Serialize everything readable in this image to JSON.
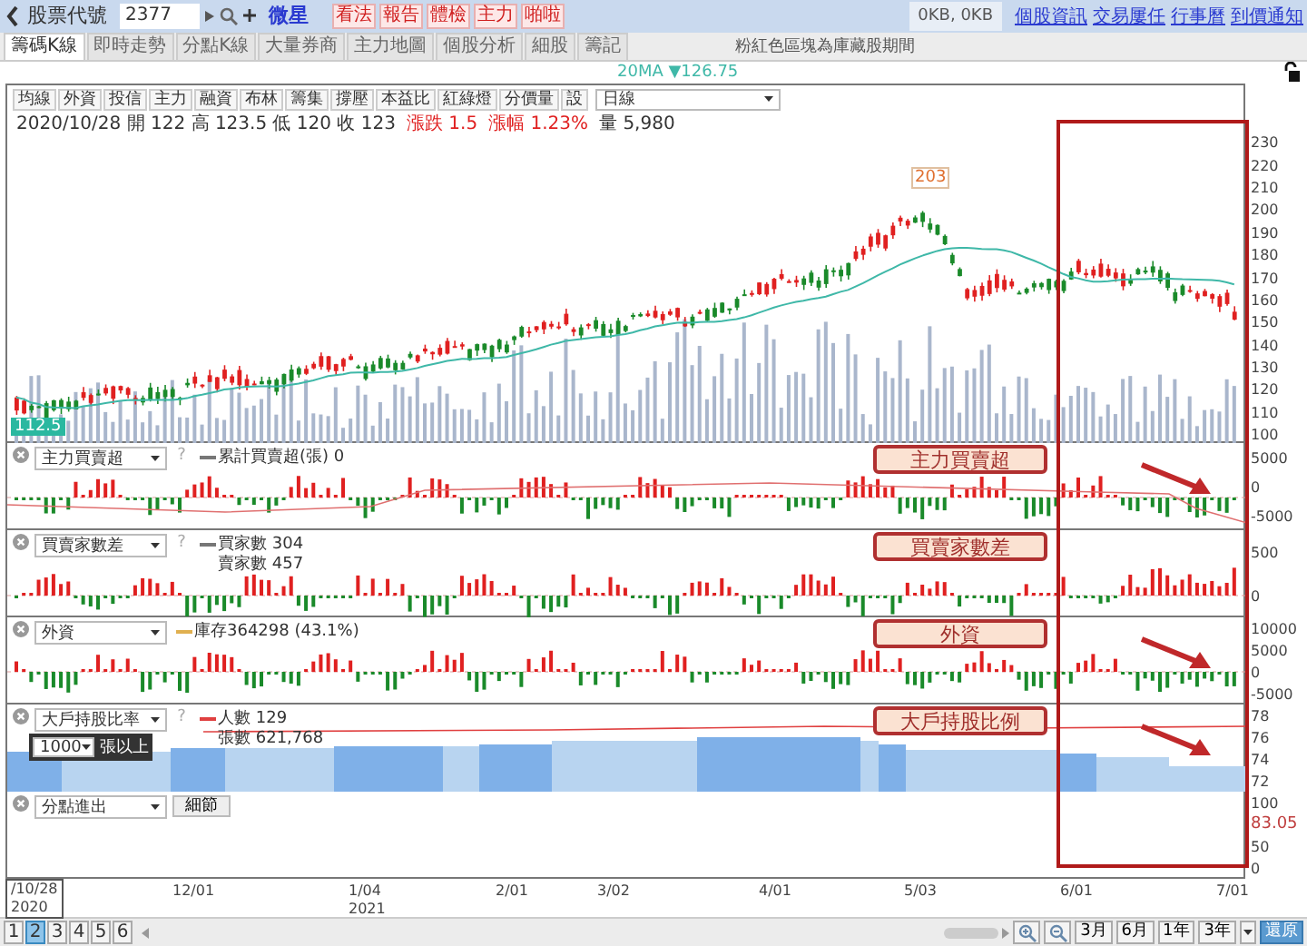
{
  "header": {
    "code_label": "股票代號",
    "code_value": "2377",
    "stock_name": "微星",
    "action_buttons": [
      "看法",
      "報告",
      "體檢",
      "主力",
      "啪啦"
    ],
    "traffic": "0KB, 0KB",
    "links": [
      "個股資訊",
      "交易屢任",
      "行事曆",
      "到價通知"
    ]
  },
  "tabs": [
    {
      "label": "籌碼K線",
      "selected": true
    },
    {
      "label": "即時走勢",
      "selected": false
    },
    {
      "label": "分點K線",
      "selected": false
    },
    {
      "label": "大量券商",
      "selected": false
    },
    {
      "label": "主力地圖",
      "selected": false
    },
    {
      "label": "個股分析",
      "selected": false
    },
    {
      "label": "細股",
      "selected": false
    },
    {
      "label": "籌記",
      "selected": false
    }
  ],
  "notice": "粉紅色區塊為庫藏股期間",
  "ma_legend": "20MA ▼126.75",
  "toolbar": {
    "buttons": [
      "均線",
      "外資",
      "投信",
      "主力",
      "融資",
      "布林",
      "籌集",
      "撐壓",
      "本益比",
      "紅綠燈",
      "分價量",
      "設"
    ],
    "period": "日線"
  },
  "quote": [
    {
      "text": "2020/10/28 開 122 高 123.5 低 120 收 123",
      "kind": "price"
    },
    {
      "text": "漲跌 1.5",
      "kind": "change"
    },
    {
      "text": "漲幅 1.23%",
      "kind": "change"
    },
    {
      "text": "量 5,980",
      "kind": "price"
    }
  ],
  "main_chart": {
    "y_labels": [
      "230",
      "220",
      "210",
      "200",
      "190",
      "180",
      "170",
      "160",
      "150",
      "140",
      "130",
      "120",
      "110",
      "100"
    ],
    "first_label": "112.5",
    "peak_label": "203"
  },
  "panels": [
    {
      "kind": "bars",
      "indicator": "主力買賣超",
      "help": "?",
      "legend": [
        {
          "text": "累計買賣超(張) 0",
          "color": "#777777"
        }
      ],
      "y_labels": [
        "5000",
        "0",
        "-5000"
      ],
      "annotation": {
        "text": "主力買賣超",
        "arrow": true
      }
    },
    {
      "kind": "bars",
      "indicator": "買賣家數差",
      "help": "?",
      "legend": [
        {
          "text": "買家數 304",
          "color": "#777777"
        },
        {
          "text": "賣家數 457"
        }
      ],
      "y_labels": [
        "500",
        "0"
      ],
      "annotation": {
        "text": "買賣家數差",
        "arrow": false
      }
    },
    {
      "kind": "bars",
      "indicator": "外資",
      "legend": [
        {
          "text": "庫存364298 (43.1%)",
          "color": "#e0b050"
        }
      ],
      "y_labels": [
        "10000",
        "5000",
        "0",
        "-5000"
      ],
      "annotation": {
        "text": "外資",
        "arrow": true
      }
    },
    {
      "kind": "area",
      "indicator": "大戶持股比率",
      "help": "?",
      "threshold": "1000",
      "threshold_unit": "張以上",
      "legend": [
        {
          "text": "人數 129",
          "color": "#e04040"
        },
        {
          "text": "張數 621,768"
        }
      ],
      "y_labels": [
        "78",
        "76",
        "74",
        "72"
      ],
      "annotation": {
        "text": "大戶持股比例",
        "arrow": true
      }
    },
    {
      "kind": "empty",
      "indicator": "分點進出",
      "detail_button": "細節",
      "y_labels": [
        "100",
        "50",
        "0"
      ],
      "value_label": "83.05"
    }
  ],
  "x_axis": [
    {
      "label": "/10/28",
      "year": "2020",
      "boxed": true
    },
    {
      "label": "12/01"
    },
    {
      "label": "1/04",
      "year": "2021"
    },
    {
      "label": "2/01"
    },
    {
      "label": "3/02"
    },
    {
      "label": "4/01"
    },
    {
      "label": "5/03"
    },
    {
      "label": "6/01"
    },
    {
      "label": "7/01"
    }
  ],
  "footer": {
    "pages": [
      {
        "label": "1",
        "selected": false
      },
      {
        "label": "2",
        "selected": true
      },
      {
        "label": "3",
        "selected": false
      },
      {
        "label": "4",
        "selected": false
      },
      {
        "label": "5",
        "selected": false
      },
      {
        "label": "6",
        "selected": false
      }
    ],
    "ranges": [
      "3月",
      "6月",
      "1年",
      "3年"
    ],
    "restore": "還原"
  }
}
